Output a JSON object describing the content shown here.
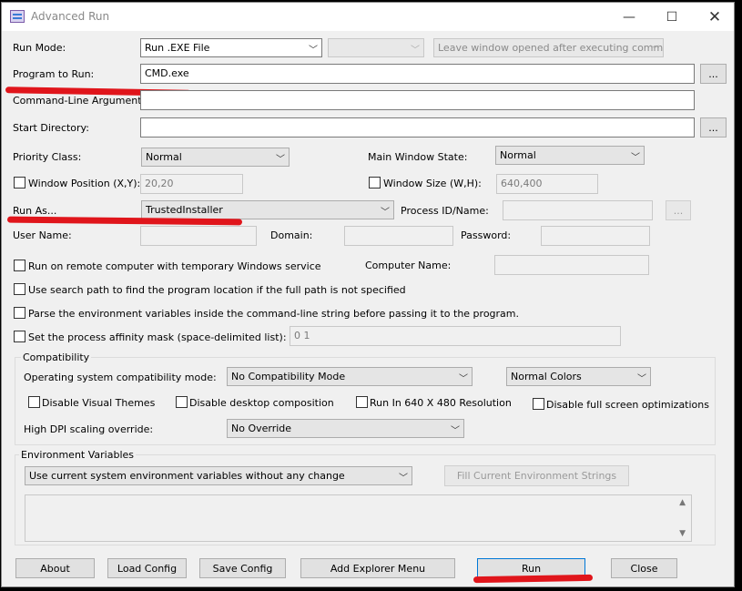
{
  "window": {
    "title": "Advanced Run",
    "minimize_glyph": "—",
    "maximize_glyph": "☐",
    "close_glyph": "✕"
  },
  "run_mode": {
    "label": "Run Mode:",
    "value": "Run .EXE File",
    "secondary_value": "",
    "window_option_value": "Leave window opened after executing command"
  },
  "program": {
    "label": "Program to Run:",
    "value": "CMD.exe",
    "browse_label": "..."
  },
  "command_line": {
    "label": "Command-Line Arguments:",
    "value": ""
  },
  "start_directory": {
    "label": "Start Directory:",
    "value": "",
    "browse_label": "..."
  },
  "priority": {
    "label": "Priority Class:",
    "value": "Normal"
  },
  "main_window_state": {
    "label": "Main Window State:",
    "value": "Normal"
  },
  "window_position": {
    "label": "Window Position (X,Y):",
    "value": "20,20"
  },
  "window_size": {
    "label": "Window Size (W,H):",
    "value": "640,400"
  },
  "run_as": {
    "label": "Run As...",
    "value": "TrustedInstaller",
    "process_label": "Process ID/Name:",
    "process_value": "",
    "process_browse_label": "..."
  },
  "credentials": {
    "user_label": "User Name:",
    "domain_label": "Domain:",
    "password_label": "Password:"
  },
  "options": {
    "remote_label": "Run on remote computer with temporary Windows service",
    "computer_name_label": "Computer Name:",
    "search_path_label": "Use search path to find the program location if the full path is not specified",
    "parse_env_label": "Parse the environment variables inside the command-line string before passing it to the program.",
    "affinity_label": "Set the process affinity mask (space-delimited list):",
    "affinity_value": "0 1"
  },
  "compatibility": {
    "group_title": "Compatibility",
    "os_label": "Operating system compatibility mode:",
    "os_value": "No Compatibility Mode",
    "colors_value": "Normal Colors",
    "disable_themes_label": "Disable Visual Themes",
    "disable_composition_label": "Disable desktop composition",
    "run_640_label": "Run In 640 X 480 Resolution",
    "disable_fullscreen_label": "Disable full screen optimizations",
    "dpi_label": "High DPI scaling override:",
    "dpi_value": "No Override"
  },
  "environment": {
    "group_title": "Environment Variables",
    "mode_value": "Use current system environment variables without any change",
    "fill_button_label": "Fill Current Environment Strings"
  },
  "bottom_buttons": {
    "about": "About",
    "load_config": "Load Config",
    "save_config": "Save Config",
    "add_explorer_menu": "Add Explorer Menu",
    "run": "Run",
    "close": "Close"
  },
  "colors": {
    "annotation_red": "#e0151b",
    "window_bg": "#f0f0f0"
  }
}
